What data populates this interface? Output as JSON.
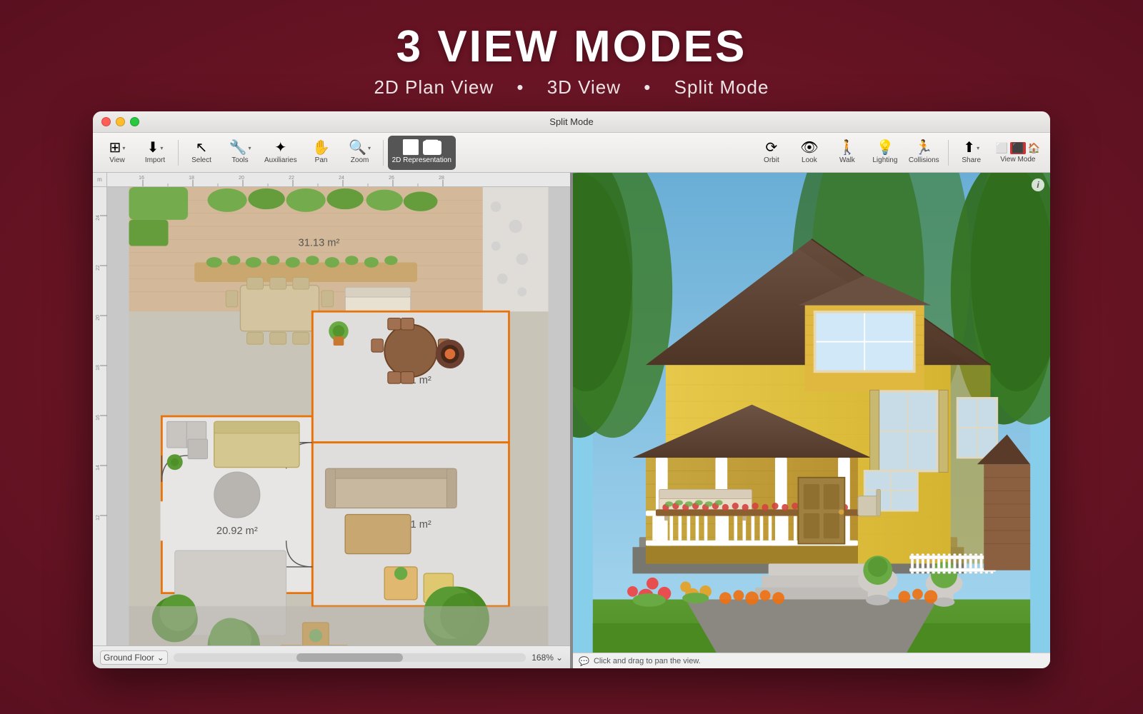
{
  "hero": {
    "title": "3 VIEW MODES",
    "subtitle_2d": "2D Plan View",
    "subtitle_3d": "3D View",
    "subtitle_split": "Split Mode",
    "dot": "•"
  },
  "titlebar": {
    "title": "Split Mode"
  },
  "toolbar": {
    "view_label": "View",
    "import_label": "Import",
    "select_label": "Select",
    "tools_label": "Tools",
    "auxiliaries_label": "Auxiliaries",
    "pan_label": "Pan",
    "zoom_label": "Zoom",
    "representation_label": "2D Representation",
    "orbit_label": "Orbit",
    "look_label": "Look",
    "walk_label": "Walk",
    "lighting_label": "Lighting",
    "collisions_label": "Collisions",
    "share_label": "Share",
    "viewmode_label": "View Mode"
  },
  "floor_plan": {
    "room1_area": "31.13 m²",
    "room2_area": "13.01 m²",
    "room3_area": "20.92 m²",
    "room4_area": "56.31 m²"
  },
  "bottom_bar": {
    "floor_name": "Ground Floor",
    "zoom_level": "168%",
    "status_text": "Click and drag to pan the view."
  }
}
